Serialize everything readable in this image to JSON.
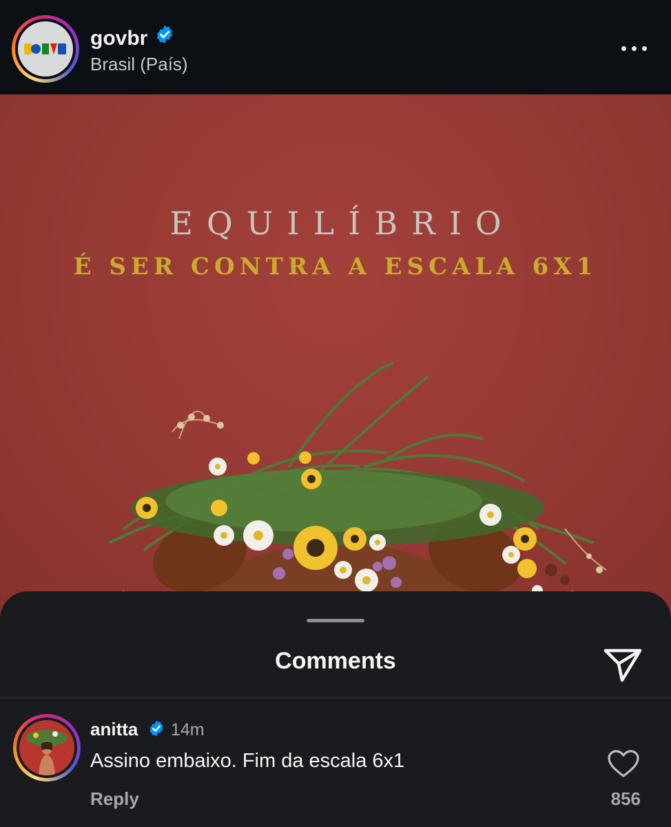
{
  "post": {
    "username": "govbr",
    "location": "Brasil (País)",
    "avatar_text": "GOV.BR",
    "more_icon": "more-horizontal-icon",
    "image": {
      "title": "EQUILÍBRIO",
      "subtitle": "É SER CONTRA A ESCALA 6X1"
    }
  },
  "comments_sheet": {
    "title": "Comments",
    "share_icon": "send-icon",
    "comments": [
      {
        "username": "anitta",
        "time": "14m",
        "text": "Assino embaixo. Fim da escala 6x1",
        "reply_label": "Reply",
        "likes": "856",
        "like_icon": "heart-icon"
      }
    ]
  },
  "colors": {
    "verified": "#0095f6",
    "background": "#0c0f13",
    "sheet": "#191b1f",
    "post_red": "#963a35",
    "subtitle_gold": "#c9ac2c"
  }
}
